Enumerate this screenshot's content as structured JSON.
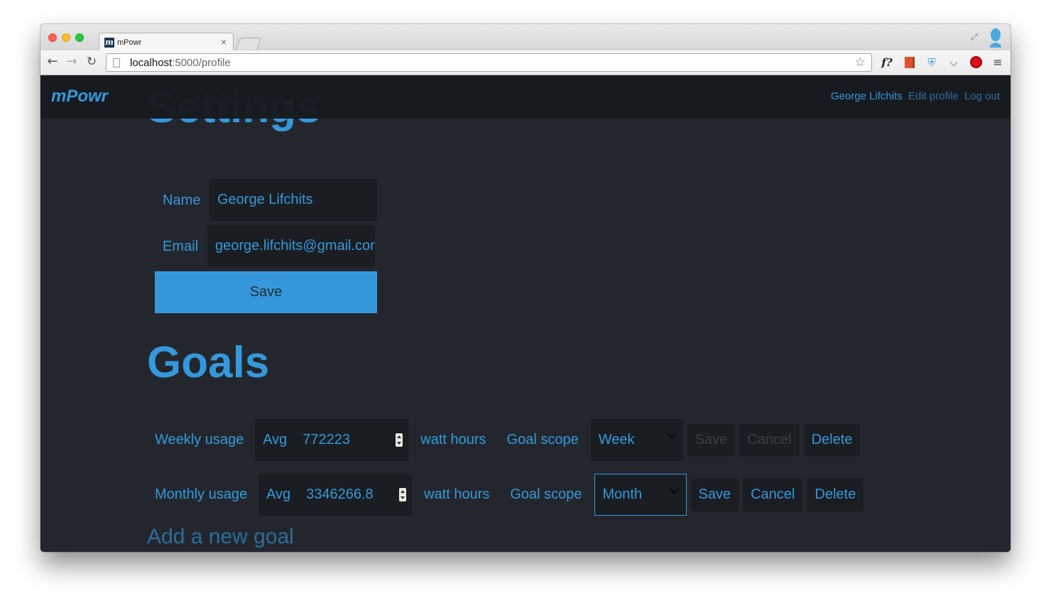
{
  "browser": {
    "tab_title": "mPowr",
    "favicon_letter": "m",
    "tab_close": "×",
    "url_host": "localhost",
    "url_rest": ":5000/profile"
  },
  "navbar": {
    "brand": "mPowr",
    "user": "George Lifchits",
    "edit_profile": "Edit profile",
    "logout": "Log out"
  },
  "settings": {
    "heading": "Settings",
    "name_label": "Name",
    "name_value": "George Lifchits",
    "email_label": "Email",
    "email_value": "george.lifchits@gmail.cor",
    "save_label": "Save"
  },
  "goals": {
    "heading": "Goals",
    "rows": [
      {
        "label": "Weekly usage",
        "agg": "Avg",
        "value": "772223",
        "unit": "watt hours",
        "scope_label": "Goal scope",
        "scope": "Week",
        "save": "Save",
        "cancel": "Cancel",
        "delete": "Delete"
      },
      {
        "label": "Monthly usage",
        "agg": "Avg",
        "value": "3346266.8",
        "unit": "watt hours",
        "scope_label": "Goal scope",
        "scope": "Month",
        "save": "Save",
        "cancel": "Cancel",
        "delete": "Delete"
      }
    ],
    "add_goal": "Add a new goal"
  },
  "colors": {
    "accent": "#3598db",
    "page_bg": "#23272d",
    "navbar_bg": "#171a1e",
    "field_bg": "#1a1d21"
  }
}
